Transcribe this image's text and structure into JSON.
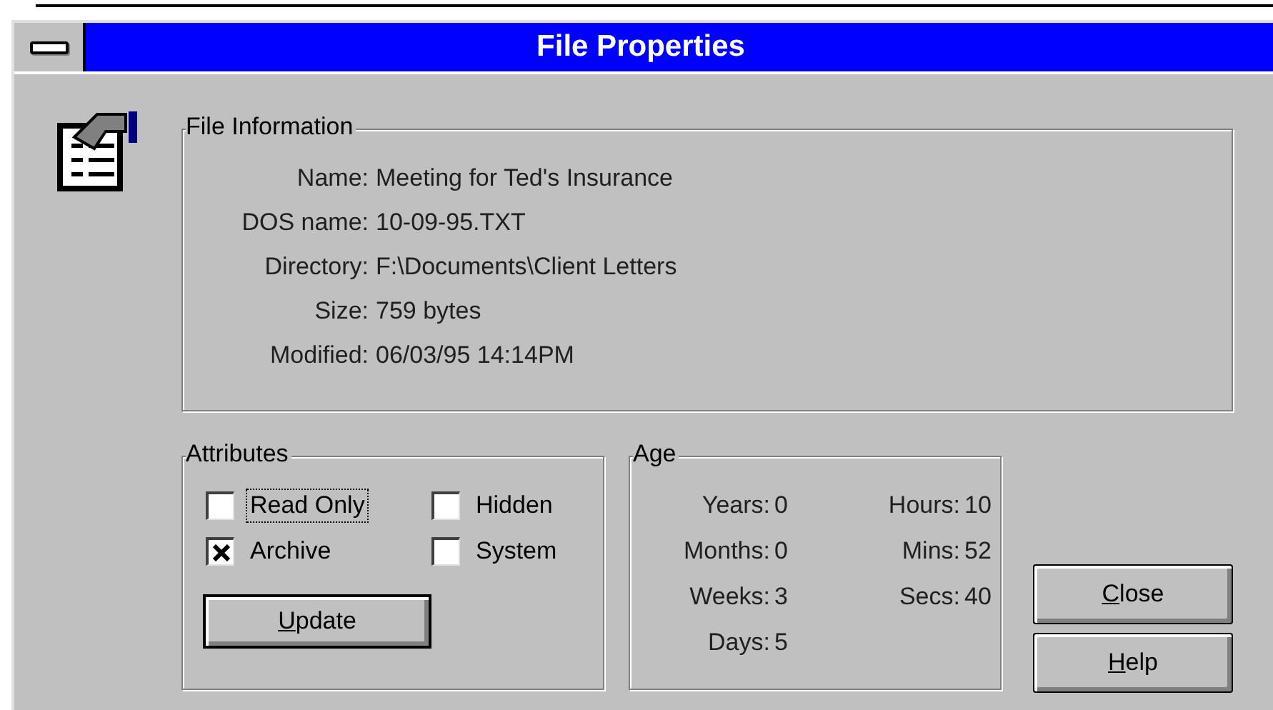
{
  "window": {
    "title": "File Properties"
  },
  "file_information": {
    "title": "File Information",
    "fields": [
      {
        "label": "Name:",
        "value": "Meeting for Ted's Insurance"
      },
      {
        "label": "DOS name:",
        "value": "10-09-95.TXT"
      },
      {
        "label": "Directory:",
        "value": "F:\\Documents\\Client Letters"
      },
      {
        "label": "Size:",
        "value": "759 bytes"
      },
      {
        "label": "Modified:",
        "value": "06/03/95 14:14PM"
      }
    ]
  },
  "attributes": {
    "title": "Attributes",
    "checkboxes": [
      {
        "label": "Read Only",
        "checked": false,
        "focused": true
      },
      {
        "label": "Hidden",
        "checked": false,
        "focused": false
      },
      {
        "label": "Archive",
        "checked": true,
        "focused": false
      },
      {
        "label": "System",
        "checked": false,
        "focused": false
      }
    ],
    "button": "Update"
  },
  "age": {
    "title": "Age",
    "columns": [
      [
        {
          "label": "Years:",
          "value": "0"
        },
        {
          "label": "Months:",
          "value": "0"
        },
        {
          "label": "Weeks:",
          "value": "3"
        },
        {
          "label": "Days:",
          "value": "5"
        }
      ],
      [
        {
          "label": "Hours:",
          "value": "10"
        },
        {
          "label": "Mins:",
          "value": "52"
        },
        {
          "label": "Secs:",
          "value": "40"
        }
      ]
    ]
  },
  "buttons": [
    "Close",
    "Help"
  ]
}
